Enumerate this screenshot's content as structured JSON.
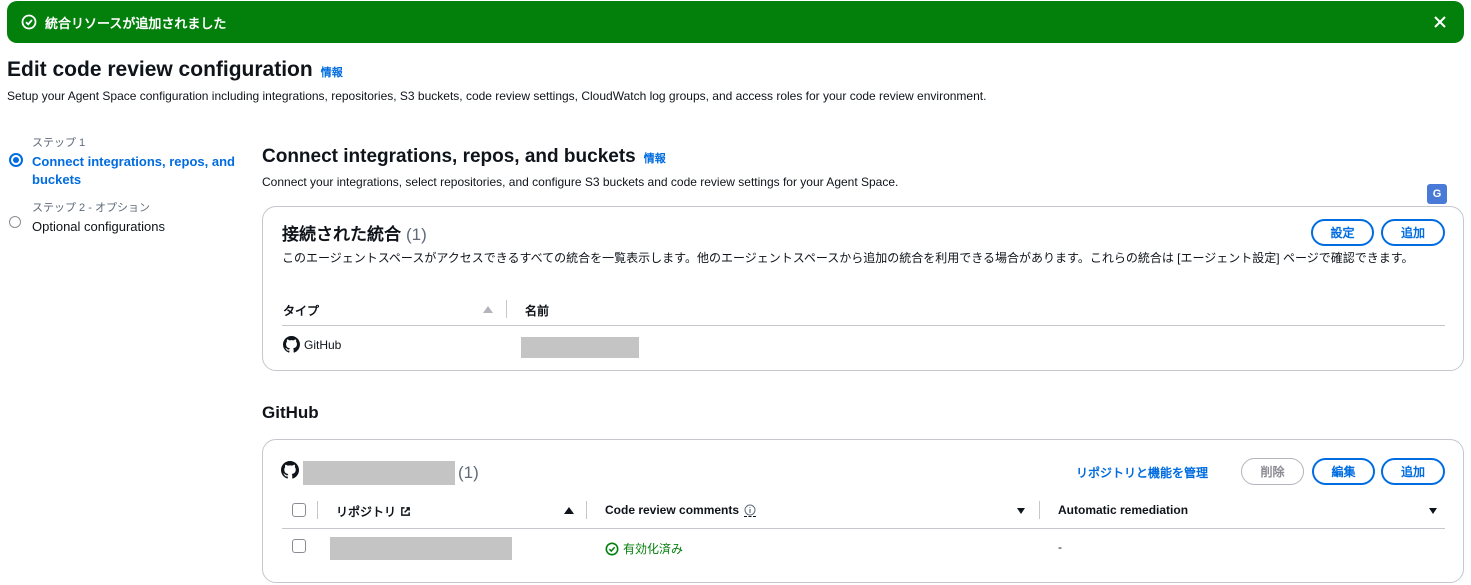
{
  "flash": {
    "message": "統合リソースが追加されました",
    "color": "#037f0c"
  },
  "page": {
    "title": "Edit code review configuration",
    "info": "情報",
    "description": "Setup your Agent Space configuration including integrations, repositories, S3 buckets, code review settings, CloudWatch log groups, and access roles for your code review environment."
  },
  "steps": [
    {
      "label": "ステップ 1",
      "title": "Connect integrations, repos, and buckets",
      "active": true
    },
    {
      "label": "ステップ 2 - オプション",
      "title": "Optional configurations",
      "active": false
    }
  ],
  "section": {
    "title": "Connect integrations, repos, and buckets",
    "info": "情報",
    "description": "Connect your integrations, select repositories, and configure S3 buckets and code review settings for your Agent Space."
  },
  "integrations": {
    "title": "接続された統合",
    "count": "(1)",
    "settings_label": "設定",
    "add_label": "追加",
    "description": "このエージェントスペースがアクセスできるすべての統合を一覧表示します。他のエージェントスペースから追加の統合を利用できる場合があります。これらの統合は [エージェント設定] ページで確認できます。",
    "columns": [
      "タイプ",
      "名前"
    ],
    "rows": [
      {
        "type": "GitHub"
      }
    ]
  },
  "github": {
    "heading": "GitHub",
    "count": "(1)",
    "manage_label": "リポジトリと機能を管理",
    "delete_label": "削除",
    "edit_label": "編集",
    "add_label": "追加",
    "columns": [
      "リポジトリ",
      "Code review comments",
      "Automatic remediation"
    ],
    "rows": [
      {
        "comments": "有効化済み",
        "remediation": "-"
      }
    ]
  },
  "colors": {
    "accent": "#006ce0",
    "success": "#037f0c",
    "border": "#c6c6cd"
  }
}
